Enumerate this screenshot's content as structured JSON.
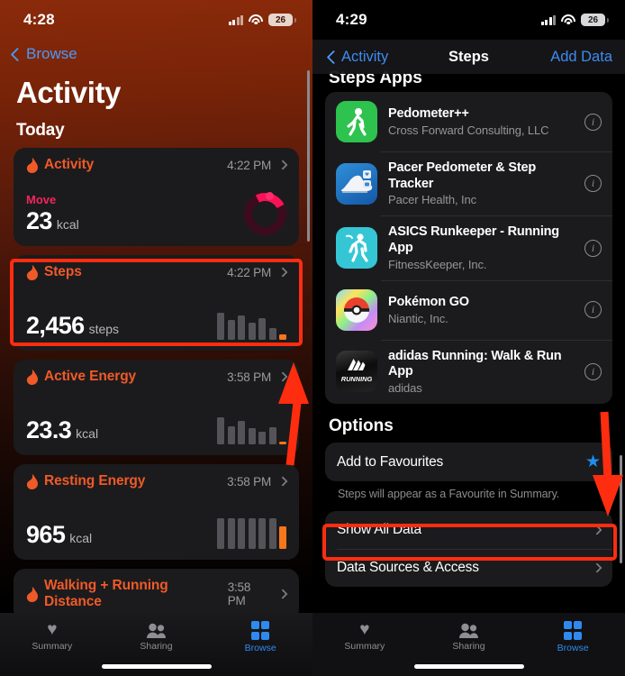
{
  "left": {
    "status": {
      "time": "4:28",
      "battery": "26"
    },
    "back_label": "Browse",
    "title": "Activity",
    "section": "Today",
    "cards": [
      {
        "name": "Activity",
        "time": "4:22 PM",
        "sublabel": "Move",
        "value": "23",
        "unit": "kcal",
        "visual": "ring"
      },
      {
        "name": "Steps",
        "time": "4:22 PM",
        "value": "2,456",
        "unit": "steps",
        "visual": "bars",
        "bars": [
          30,
          22,
          27,
          19,
          24,
          13,
          6
        ],
        "highlight_index": 6,
        "highlighted": true
      },
      {
        "name": "Active Energy",
        "time": "3:58 PM",
        "value": "23.3",
        "unit": "kcal",
        "visual": "bars",
        "bars": [
          30,
          20,
          26,
          18,
          14,
          19,
          3
        ],
        "highlight_index": 6
      },
      {
        "name": "Resting Energy",
        "time": "3:58 PM",
        "value": "965",
        "unit": "kcal",
        "visual": "bars",
        "bars": [
          34,
          34,
          34,
          34,
          34,
          34,
          25
        ],
        "highlight_index": 6
      },
      {
        "name": "Walking + Running Distance",
        "time": "3:58 PM",
        "value": "",
        "unit": "",
        "visual": "none"
      }
    ],
    "tabs": [
      {
        "label": "Summary",
        "icon": "heart-icon",
        "active": false
      },
      {
        "label": "Sharing",
        "icon": "people-icon",
        "active": false
      },
      {
        "label": "Browse",
        "icon": "grid-icon",
        "active": true
      }
    ]
  },
  "right": {
    "status": {
      "time": "4:29",
      "battery": "26"
    },
    "nav": {
      "back": "Activity",
      "title": "Steps",
      "action": "Add Data"
    },
    "apps_header": "Steps Apps",
    "apps": [
      {
        "name": "Pedometer++",
        "developer": "Cross Forward Consulting, LLC",
        "icon": "pedometer-app-icon"
      },
      {
        "name": "Pacer Pedometer & Step Tracker",
        "developer": "Pacer Health, Inc",
        "icon": "pacer-app-icon"
      },
      {
        "name": "ASICS Runkeeper - Running App",
        "developer": "FitnessKeeper, Inc.",
        "icon": "runkeeper-app-icon"
      },
      {
        "name": "Pokémon GO",
        "developer": "Niantic, Inc.",
        "icon": "pokemon-go-app-icon"
      },
      {
        "name": "adidas Running: Walk & Run App",
        "developer": "adidas",
        "icon": "adidas-running-app-icon"
      }
    ],
    "options_header": "Options",
    "options": [
      {
        "label": "Add to Favourites",
        "accessory": "star"
      }
    ],
    "options_footnote": "Steps will appear as a Favourite in Summary.",
    "actions": [
      {
        "label": "Show All Data",
        "accessory": "chevron",
        "highlighted": true
      },
      {
        "label": "Data Sources & Access",
        "accessory": "chevron",
        "highlighted": false
      }
    ],
    "tabs": [
      {
        "label": "Summary",
        "icon": "heart-icon",
        "active": false
      },
      {
        "label": "Sharing",
        "icon": "people-icon",
        "active": false
      },
      {
        "label": "Browse",
        "icon": "grid-icon",
        "active": true
      }
    ]
  },
  "annotations": {
    "color": "#ff2d10"
  }
}
